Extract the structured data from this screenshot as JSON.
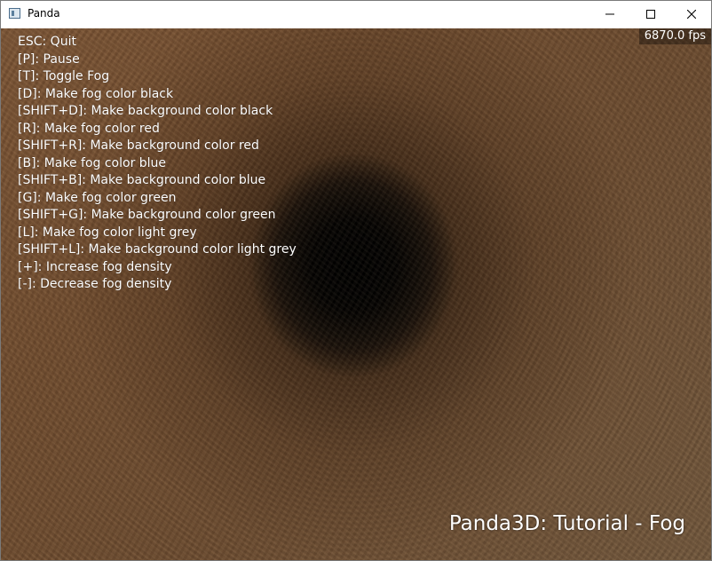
{
  "window": {
    "title": "Panda",
    "app_icon": "panda-app-icon",
    "controls": {
      "minimize_icon": "minimize-icon",
      "maximize_icon": "maximize-icon",
      "close_icon": "close-icon"
    }
  },
  "scene": {
    "fps": "6870.0 fps",
    "title": "Panda3D: Tutorial - Fog",
    "instructions": [
      "ESC: Quit",
      "[P]: Pause",
      "[T]: Toggle Fog",
      "[D]: Make fog color black",
      "[SHIFT+D]: Make background color black",
      "[R]: Make fog color red",
      "[SHIFT+R]: Make background color red",
      "[B]: Make fog color blue",
      "[SHIFT+B]: Make background color blue",
      "[G]: Make fog color green",
      "[SHIFT+G]: Make background color green",
      "[L]: Make fog color light grey",
      "[SHIFT+L]: Make background color light grey",
      "[+]: Increase fog density",
      "[-]: Decrease fog density"
    ]
  },
  "colors": {
    "tunnel_wall": "#6e4a2d",
    "tunnel_center": "#000000",
    "overlay_text": "#ffffff"
  }
}
